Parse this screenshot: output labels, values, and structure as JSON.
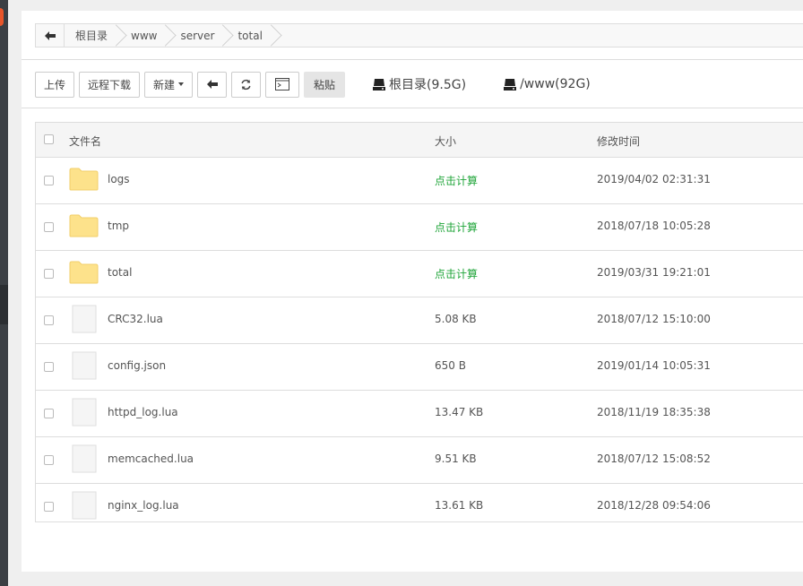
{
  "breadcrumb": {
    "segments": [
      "根目录",
      "www",
      "server",
      "total"
    ]
  },
  "toolbar": {
    "upload": "上传",
    "remote_download": "远程下载",
    "new": "新建",
    "paste": "粘贴"
  },
  "disks": [
    {
      "label": "根目录(9.5G)"
    },
    {
      "label": "/www(92G)"
    }
  ],
  "table": {
    "headers": {
      "name": "文件名",
      "size": "大小",
      "modified": "修改时间"
    },
    "rows": [
      {
        "type": "folder",
        "name": "logs",
        "size": "点击计算",
        "modified": "2019/04/02 02:31:31"
      },
      {
        "type": "folder",
        "name": "tmp",
        "size": "点击计算",
        "modified": "2018/07/18 10:05:28"
      },
      {
        "type": "folder",
        "name": "total",
        "size": "点击计算",
        "modified": "2019/03/31 19:21:01"
      },
      {
        "type": "file",
        "name": "CRC32.lua",
        "size": "5.08 KB",
        "modified": "2018/07/12 15:10:00"
      },
      {
        "type": "file",
        "name": "config.json",
        "size": "650 B",
        "modified": "2019/01/14 10:05:31"
      },
      {
        "type": "file",
        "name": "httpd_log.lua",
        "size": "13.47 KB",
        "modified": "2018/11/19 18:35:38"
      },
      {
        "type": "file",
        "name": "memcached.lua",
        "size": "9.51 KB",
        "modified": "2018/07/12 15:08:52"
      },
      {
        "type": "file",
        "name": "nginx_log.lua",
        "size": "13.61 KB",
        "modified": "2018/12/28 09:54:06"
      }
    ]
  },
  "colors": {
    "calc_link": "#20a53a",
    "folder": "#fde28b",
    "accent_orange": "#e8552a"
  },
  "icons": {
    "back": "arrow-left-icon",
    "refresh": "refresh-icon",
    "terminal": "terminal-icon",
    "disk": "hard-drive-icon",
    "folder": "folder-icon",
    "file": "file-icon"
  }
}
